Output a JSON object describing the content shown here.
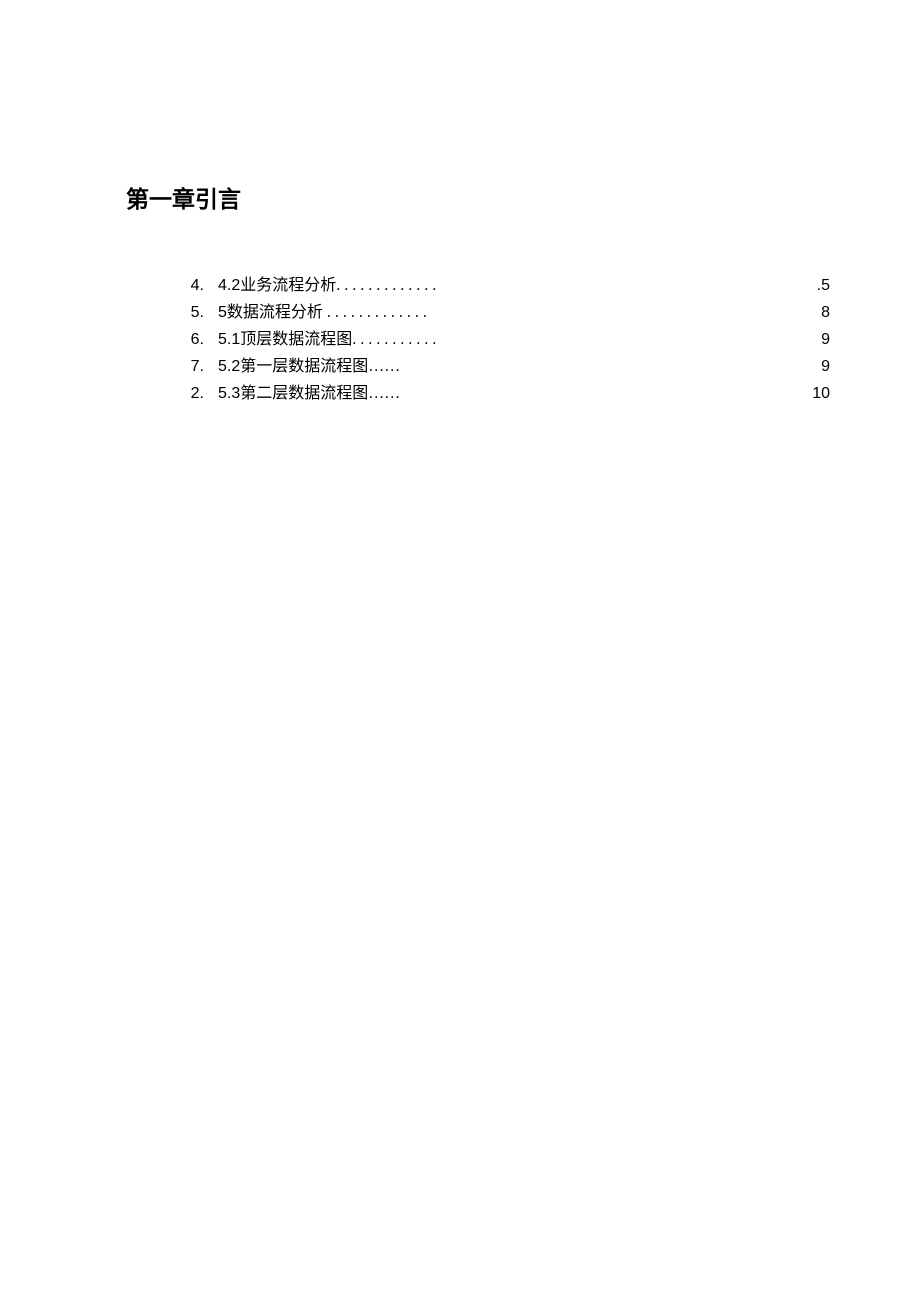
{
  "chapter_title": "第一章引言",
  "toc": [
    {
      "num": "4.",
      "section": "4.2",
      "title": "业务流程分析",
      "dots": ". . . . . . . . . . . . .",
      "page": ".5"
    },
    {
      "num": "5.",
      "section": "5",
      "title": "数据流程分析",
      "dots": " . . . . . . . . . . . . .",
      "page": "8"
    },
    {
      "num": "6.",
      "section": "5.1",
      "title": "顶层数据流程图",
      "dots": ". . . . . . . . . . .",
      "page": "9"
    },
    {
      "num": "7.",
      "section": "5.2",
      "title": "第一层数据流程图",
      "dots": "……",
      "page": "9"
    },
    {
      "num": "2.",
      "section": "5.3",
      "title": "第二层数据流程图",
      "dots": "……",
      "page": "10"
    }
  ]
}
